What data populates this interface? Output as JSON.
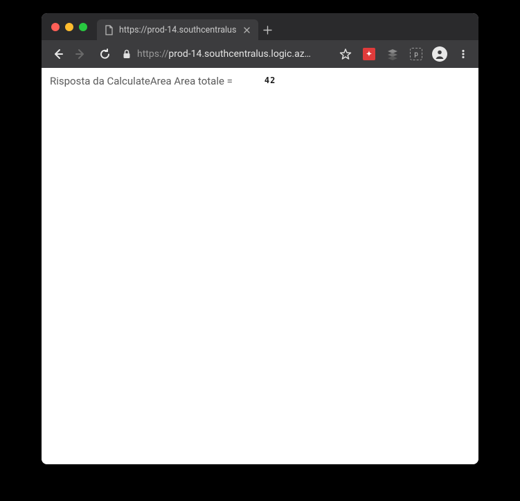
{
  "tab": {
    "title": "https://prod-14.southcentralus"
  },
  "url": {
    "scheme": "https://",
    "display": "prod-14.southcentralus.logic.az",
    "ellipsis": "…"
  },
  "extensions": {
    "ab_glyph": "✦",
    "box_glyph": "p"
  },
  "page": {
    "body_text": "Risposta da CalculateArea Area totale =",
    "result_value": "42"
  }
}
